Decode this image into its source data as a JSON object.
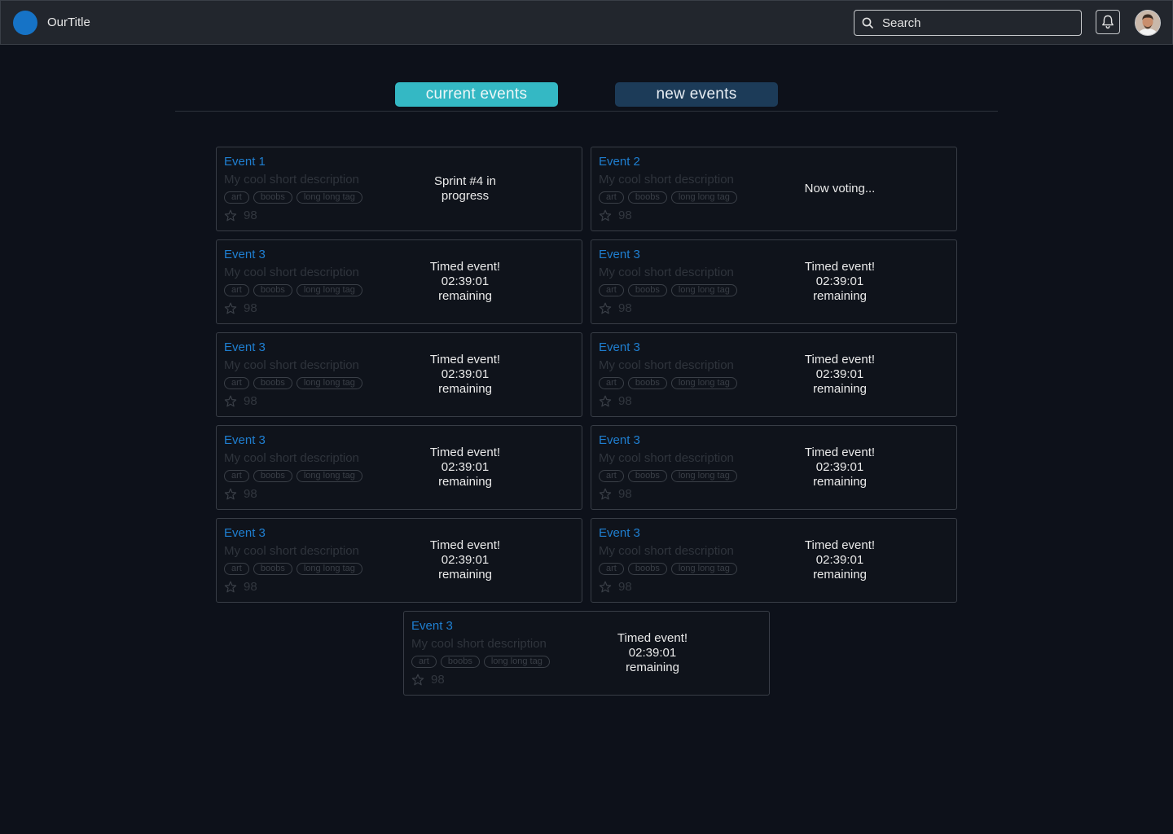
{
  "app": {
    "title": "OurTitle"
  },
  "header": {
    "search_placeholder": "Search"
  },
  "tabs": [
    {
      "label": "current events",
      "active": true
    },
    {
      "label": "new events",
      "active": false
    }
  ],
  "colors": {
    "accent": "#1673c6",
    "tab_active": "#34b8c4",
    "tab_inactive": "#1c3b58",
    "event_title": "#1f7fd1",
    "background": "#0d111a"
  },
  "events": [
    {
      "title": "Event 1",
      "description": "My cool short description",
      "tags": [
        "art",
        "boobs",
        "long long tag"
      ],
      "rating": "98",
      "status": "Sprint #4 in\nprogress"
    },
    {
      "title": "Event 2",
      "description": "My cool short description",
      "tags": [
        "art",
        "boobs",
        "long long tag"
      ],
      "rating": "98",
      "status": "Now voting..."
    },
    {
      "title": "Event 3",
      "description": "My cool short description",
      "tags": [
        "art",
        "boobs",
        "long long tag"
      ],
      "rating": "98",
      "status": "Timed event!\n02:39:01\nremaining"
    },
    {
      "title": "Event 3",
      "description": "My cool short description",
      "tags": [
        "art",
        "boobs",
        "long long tag"
      ],
      "rating": "98",
      "status": "Timed event!\n02:39:01\nremaining"
    },
    {
      "title": "Event 3",
      "description": "My cool short description",
      "tags": [
        "art",
        "boobs",
        "long long tag"
      ],
      "rating": "98",
      "status": "Timed event!\n02:39:01\nremaining"
    },
    {
      "title": "Event 3",
      "description": "My cool short description",
      "tags": [
        "art",
        "boobs",
        "long long tag"
      ],
      "rating": "98",
      "status": "Timed event!\n02:39:01\nremaining"
    },
    {
      "title": "Event 3",
      "description": "My cool short description",
      "tags": [
        "art",
        "boobs",
        "long long tag"
      ],
      "rating": "98",
      "status": "Timed event!\n02:39:01\nremaining"
    },
    {
      "title": "Event 3",
      "description": "My cool short description",
      "tags": [
        "art",
        "boobs",
        "long long tag"
      ],
      "rating": "98",
      "status": "Timed event!\n02:39:01\nremaining"
    },
    {
      "title": "Event 3",
      "description": "My cool short description",
      "tags": [
        "art",
        "boobs",
        "long long tag"
      ],
      "rating": "98",
      "status": "Timed event!\n02:39:01\nremaining"
    },
    {
      "title": "Event 3",
      "description": "My cool short description",
      "tags": [
        "art",
        "boobs",
        "long long tag"
      ],
      "rating": "98",
      "status": "Timed event!\n02:39:01\nremaining"
    },
    {
      "title": "Event 3",
      "description": "My cool short description",
      "tags": [
        "art",
        "boobs",
        "long long tag"
      ],
      "rating": "98",
      "status": "Timed event!\n02:39:01\nremaining"
    }
  ]
}
